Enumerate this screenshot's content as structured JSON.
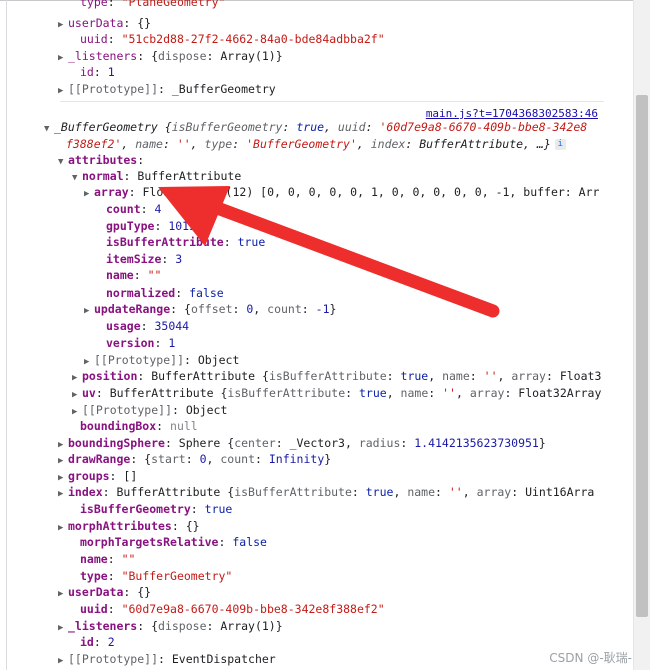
{
  "source_link": "main.js?t=1704368302583:46",
  "watermark": "CSDN @-耿瑞-",
  "info_icon": "i",
  "arrow_color": "#ee2d2d",
  "lines": [
    {
      "indent": 80,
      "t": "",
      "parts": [
        {
          "c": "k",
          "v": "type"
        },
        {
          "c": "",
          "v": ": "
        },
        {
          "c": "str",
          "v": "\"PlaneGeometry\""
        }
      ]
    },
    {
      "indent": 70,
      "t": "▶",
      "parts": [
        {
          "c": "k",
          "v": "userData"
        },
        {
          "c": "",
          "v": ": {}"
        }
      ]
    },
    {
      "indent": 80,
      "t": "",
      "parts": [
        {
          "c": "k",
          "v": "uuid"
        },
        {
          "c": "",
          "v": ": "
        },
        {
          "c": "str",
          "v": "\"51cb2d88-27f2-4662-84a0-bde84adbba2f\""
        }
      ]
    },
    {
      "indent": 70,
      "t": "▶",
      "parts": [
        {
          "c": "k",
          "v": "_listeners"
        },
        {
          "c": "",
          "v": ": {"
        },
        {
          "c": "gry",
          "v": "dispose"
        },
        {
          "c": "",
          "v": ": Array(1)}"
        }
      ]
    },
    {
      "indent": 80,
      "t": "",
      "parts": [
        {
          "c": "k",
          "v": "id"
        },
        {
          "c": "",
          "v": ": "
        },
        {
          "c": "num",
          "v": "1"
        }
      ]
    },
    {
      "indent": 70,
      "t": "▶",
      "parts": [
        {
          "c": "gry",
          "v": "[[Prototype]]"
        },
        {
          "c": "",
          "v": ": _BufferGeometry"
        }
      ]
    },
    {
      "indent": 56,
      "t": "▼",
      "parts": [
        {
          "c": "ital",
          "v": "_BufferGeometry {"
        },
        {
          "c": "ital gry",
          "v": "isBufferGeometry"
        },
        {
          "c": "ital",
          "v": ": "
        },
        {
          "c": "ital kw",
          "v": "true"
        },
        {
          "c": "ital",
          "v": ", "
        },
        {
          "c": "ital gry",
          "v": "uuid"
        },
        {
          "c": "ital",
          "v": ": "
        },
        {
          "c": "ital str",
          "v": "'60d7e9a8-6670-409b-bbe8-342e8"
        }
      ]
    },
    {
      "indent": 66,
      "t": "",
      "parts": [
        {
          "c": "ital str",
          "v": "f388ef2'"
        },
        {
          "c": "ital",
          "v": ", "
        },
        {
          "c": "ital gry",
          "v": "name"
        },
        {
          "c": "ital",
          "v": ": "
        },
        {
          "c": "ital str",
          "v": "''"
        },
        {
          "c": "ital",
          "v": ", "
        },
        {
          "c": "ital gry",
          "v": "type"
        },
        {
          "c": "ital",
          "v": ": "
        },
        {
          "c": "ital str",
          "v": "'BufferGeometry'"
        },
        {
          "c": "ital",
          "v": ", "
        },
        {
          "c": "ital gry",
          "v": "index"
        },
        {
          "c": "ital",
          "v": ": BufferAttribute, …}"
        }
      ]
    },
    {
      "indent": 70,
      "t": "▼",
      "parts": [
        {
          "c": "kp",
          "v": "attributes"
        },
        {
          "c": "",
          "v": ":"
        }
      ]
    },
    {
      "indent": 84,
      "t": "▼",
      "parts": [
        {
          "c": "kp",
          "v": "normal"
        },
        {
          "c": "",
          "v": ": BufferAttribute"
        }
      ]
    },
    {
      "indent": 96,
      "t": "▶",
      "parts": [
        {
          "c": "kp",
          "v": "array"
        },
        {
          "c": "",
          "v": ": Float32Array(12) [0, 0, 0, 0, 0, 1, 0, 0, 0, 0, 0, -1, buffer: Arr"
        }
      ]
    },
    {
      "indent": 106,
      "t": "",
      "parts": [
        {
          "c": "kp",
          "v": "count"
        },
        {
          "c": "",
          "v": ": "
        },
        {
          "c": "num",
          "v": "4"
        }
      ]
    },
    {
      "indent": 106,
      "t": "",
      "parts": [
        {
          "c": "kp",
          "v": "gpuType"
        },
        {
          "c": "",
          "v": ": "
        },
        {
          "c": "num",
          "v": "1015"
        }
      ]
    },
    {
      "indent": 106,
      "t": "",
      "parts": [
        {
          "c": "kp",
          "v": "isBufferAttribute"
        },
        {
          "c": "",
          "v": ": "
        },
        {
          "c": "kw",
          "v": "true"
        }
      ]
    },
    {
      "indent": 106,
      "t": "",
      "parts": [
        {
          "c": "kp",
          "v": "itemSize"
        },
        {
          "c": "",
          "v": ": "
        },
        {
          "c": "num",
          "v": "3"
        }
      ]
    },
    {
      "indent": 106,
      "t": "",
      "parts": [
        {
          "c": "kp",
          "v": "name"
        },
        {
          "c": "",
          "v": ": "
        },
        {
          "c": "str",
          "v": "\"\""
        }
      ]
    },
    {
      "indent": 106,
      "t": "",
      "parts": [
        {
          "c": "kp",
          "v": "normalized"
        },
        {
          "c": "",
          "v": ": "
        },
        {
          "c": "kw",
          "v": "false"
        }
      ]
    },
    {
      "indent": 96,
      "t": "▶",
      "parts": [
        {
          "c": "kp",
          "v": "updateRange"
        },
        {
          "c": "",
          "v": ": {"
        },
        {
          "c": "gry",
          "v": "offset"
        },
        {
          "c": "",
          "v": ": "
        },
        {
          "c": "num",
          "v": "0"
        },
        {
          "c": "",
          "v": ", "
        },
        {
          "c": "gry",
          "v": "count"
        },
        {
          "c": "",
          "v": ": "
        },
        {
          "c": "num",
          "v": "-1"
        },
        {
          "c": "",
          "v": "}"
        }
      ]
    },
    {
      "indent": 106,
      "t": "",
      "parts": [
        {
          "c": "kp",
          "v": "usage"
        },
        {
          "c": "",
          "v": ": "
        },
        {
          "c": "num",
          "v": "35044"
        }
      ]
    },
    {
      "indent": 106,
      "t": "",
      "parts": [
        {
          "c": "kp",
          "v": "version"
        },
        {
          "c": "",
          "v": ": "
        },
        {
          "c": "num",
          "v": "1"
        }
      ]
    },
    {
      "indent": 96,
      "t": "▶",
      "parts": [
        {
          "c": "gry",
          "v": "[[Prototype]]"
        },
        {
          "c": "",
          "v": ": Object"
        }
      ]
    },
    {
      "indent": 84,
      "t": "▶",
      "parts": [
        {
          "c": "kp",
          "v": "position"
        },
        {
          "c": "",
          "v": ": BufferAttribute {"
        },
        {
          "c": "gry",
          "v": "isBufferAttribute"
        },
        {
          "c": "",
          "v": ": "
        },
        {
          "c": "kw",
          "v": "true"
        },
        {
          "c": "",
          "v": ", "
        },
        {
          "c": "gry",
          "v": "name"
        },
        {
          "c": "",
          "v": ": "
        },
        {
          "c": "str",
          "v": "''"
        },
        {
          "c": "",
          "v": ", "
        },
        {
          "c": "gry",
          "v": "array"
        },
        {
          "c": "",
          "v": ": Float3"
        }
      ]
    },
    {
      "indent": 84,
      "t": "▶",
      "parts": [
        {
          "c": "kp",
          "v": "uv"
        },
        {
          "c": "",
          "v": ": BufferAttribute {"
        },
        {
          "c": "gry",
          "v": "isBufferAttribute"
        },
        {
          "c": "",
          "v": ": "
        },
        {
          "c": "kw",
          "v": "true"
        },
        {
          "c": "",
          "v": ", "
        },
        {
          "c": "gry",
          "v": "name"
        },
        {
          "c": "",
          "v": ": "
        },
        {
          "c": "str",
          "v": "''"
        },
        {
          "c": "",
          "v": ", "
        },
        {
          "c": "gry",
          "v": "array"
        },
        {
          "c": "",
          "v": ": Float32Array"
        }
      ]
    },
    {
      "indent": 84,
      "t": "▶",
      "parts": [
        {
          "c": "gry",
          "v": "[[Prototype]]"
        },
        {
          "c": "",
          "v": ": Object"
        }
      ]
    },
    {
      "indent": 80,
      "t": "",
      "parts": [
        {
          "c": "kp",
          "v": "boundingBox"
        },
        {
          "c": "",
          "v": ": "
        },
        {
          "c": "nul",
          "v": "null"
        }
      ]
    },
    {
      "indent": 70,
      "t": "▶",
      "parts": [
        {
          "c": "kp",
          "v": "boundingSphere"
        },
        {
          "c": "",
          "v": ": Sphere {"
        },
        {
          "c": "gry",
          "v": "center"
        },
        {
          "c": "",
          "v": ": _Vector3, "
        },
        {
          "c": "gry",
          "v": "radius"
        },
        {
          "c": "",
          "v": ": "
        },
        {
          "c": "num",
          "v": "1.4142135623730951"
        },
        {
          "c": "",
          "v": "}"
        }
      ]
    },
    {
      "indent": 70,
      "t": "▶",
      "parts": [
        {
          "c": "kp",
          "v": "drawRange"
        },
        {
          "c": "",
          "v": ": {"
        },
        {
          "c": "gry",
          "v": "start"
        },
        {
          "c": "",
          "v": ": "
        },
        {
          "c": "num",
          "v": "0"
        },
        {
          "c": "",
          "v": ", "
        },
        {
          "c": "gry",
          "v": "count"
        },
        {
          "c": "",
          "v": ": "
        },
        {
          "c": "num",
          "v": "Infinity"
        },
        {
          "c": "",
          "v": "}"
        }
      ]
    },
    {
      "indent": 70,
      "t": "▶",
      "parts": [
        {
          "c": "kp",
          "v": "groups"
        },
        {
          "c": "",
          "v": ": []"
        }
      ]
    },
    {
      "indent": 70,
      "t": "▶",
      "parts": [
        {
          "c": "kp",
          "v": "index"
        },
        {
          "c": "",
          "v": ": BufferAttribute {"
        },
        {
          "c": "gry",
          "v": "isBufferAttribute"
        },
        {
          "c": "",
          "v": ": "
        },
        {
          "c": "kw",
          "v": "true"
        },
        {
          "c": "",
          "v": ", "
        },
        {
          "c": "gry",
          "v": "name"
        },
        {
          "c": "",
          "v": ": "
        },
        {
          "c": "str",
          "v": "''"
        },
        {
          "c": "",
          "v": ", "
        },
        {
          "c": "gry",
          "v": "array"
        },
        {
          "c": "",
          "v": ": Uint16Arra"
        }
      ]
    },
    {
      "indent": 80,
      "t": "",
      "parts": [
        {
          "c": "kp",
          "v": "isBufferGeometry"
        },
        {
          "c": "",
          "v": ": "
        },
        {
          "c": "kw",
          "v": "true"
        }
      ]
    },
    {
      "indent": 70,
      "t": "▶",
      "parts": [
        {
          "c": "kp",
          "v": "morphAttributes"
        },
        {
          "c": "",
          "v": ": {}"
        }
      ]
    },
    {
      "indent": 80,
      "t": "",
      "parts": [
        {
          "c": "kp",
          "v": "morphTargetsRelative"
        },
        {
          "c": "",
          "v": ": "
        },
        {
          "c": "kw",
          "v": "false"
        }
      ]
    },
    {
      "indent": 80,
      "t": "",
      "parts": [
        {
          "c": "kp",
          "v": "name"
        },
        {
          "c": "",
          "v": ": "
        },
        {
          "c": "str",
          "v": "\"\""
        }
      ]
    },
    {
      "indent": 80,
      "t": "",
      "parts": [
        {
          "c": "kp",
          "v": "type"
        },
        {
          "c": "",
          "v": ": "
        },
        {
          "c": "str",
          "v": "\"BufferGeometry\""
        }
      ]
    },
    {
      "indent": 70,
      "t": "▶",
      "parts": [
        {
          "c": "kp",
          "v": "userData"
        },
        {
          "c": "",
          "v": ": {}"
        }
      ]
    },
    {
      "indent": 80,
      "t": "",
      "parts": [
        {
          "c": "kp",
          "v": "uuid"
        },
        {
          "c": "",
          "v": ": "
        },
        {
          "c": "str",
          "v": "\"60d7e9a8-6670-409b-bbe8-342e8f388ef2\""
        }
      ]
    },
    {
      "indent": 70,
      "t": "▶",
      "parts": [
        {
          "c": "kp",
          "v": "_listeners"
        },
        {
          "c": "",
          "v": ": {"
        },
        {
          "c": "gry",
          "v": "dispose"
        },
        {
          "c": "",
          "v": ": Array(1)}"
        }
      ]
    },
    {
      "indent": 80,
      "t": "",
      "parts": [
        {
          "c": "kp",
          "v": "id"
        },
        {
          "c": "",
          "v": ": "
        },
        {
          "c": "num",
          "v": "2"
        }
      ]
    },
    {
      "indent": 70,
      "t": "▶",
      "parts": [
        {
          "c": "gry",
          "v": "[[Prototype]]"
        },
        {
          "c": "",
          "v": ": EventDispatcher"
        }
      ]
    }
  ]
}
